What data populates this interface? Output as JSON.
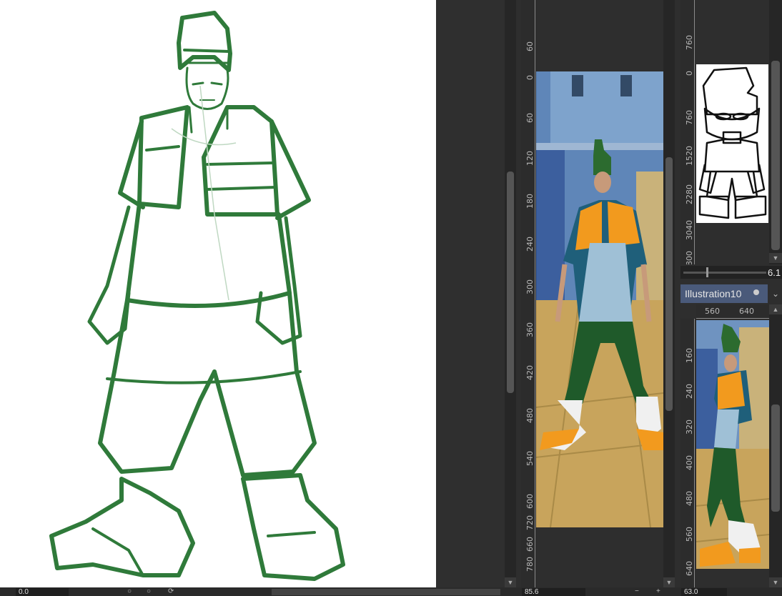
{
  "main_view": {
    "vertical_ruler_labels": [
      "60",
      "0",
      "60",
      "120",
      "180",
      "240",
      "300",
      "360",
      "420",
      "480",
      "540",
      "600",
      "660",
      "720",
      "780"
    ]
  },
  "navigator": {
    "ruler_labels": [
      "760",
      "0",
      "760",
      "1520",
      "2280",
      "3040",
      "800"
    ],
    "zoom_value": "6.1"
  },
  "sub_view": {
    "tab_label": "Illustration10",
    "top_ruler_labels": [
      "560",
      "640"
    ],
    "left_ruler_labels": [
      "160",
      "240",
      "320",
      "400",
      "480",
      "560",
      "640"
    ]
  },
  "status_bar": {
    "main_zoom": "0.0",
    "sub_zoom": "85.6",
    "nav_zoom": "63.0"
  },
  "colors": {
    "sketch_green": "#2f7a3a",
    "orange_vest": "#f29a1e",
    "teal_shirt": "#1f5f7a",
    "pants_green": "#1f5a2a"
  },
  "icons": {
    "scroll_up": "▲",
    "scroll_down": "▼",
    "tab_menu": "chevron-down-icon",
    "zoom_minus": "−",
    "zoom_plus": "+",
    "rotate": "rotate-icon"
  }
}
